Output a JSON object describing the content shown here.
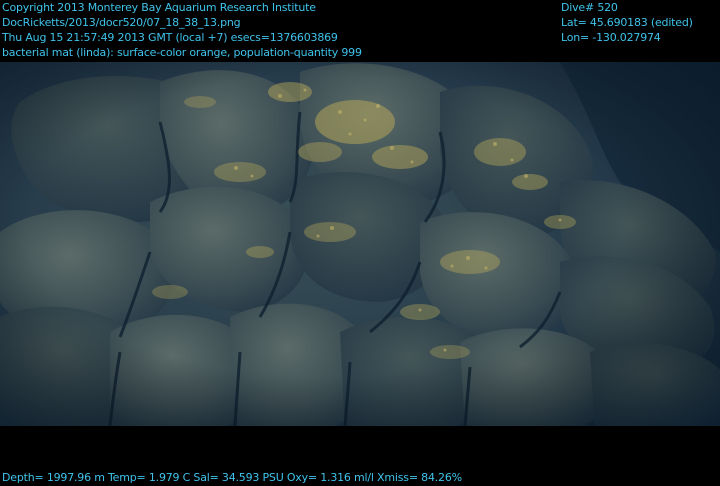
{
  "overlay": {
    "copyright": "Copyright 2013 Monterey Bay Aquarium Research Institute",
    "file_path": "DocRicketts/2013/docr520/07_18_38_13.png",
    "timestamp": "Thu Aug 15 21:57:49 2013 GMT (local +7)  esecs=1376603869",
    "annotation": "bacterial mat (linda): surface-color orange, population-quantity 999",
    "dive": "Dive# 520",
    "latitude": "Lat= 45.690183 (edited)",
    "longitude": "Lon= -130.027974",
    "sensors": "Depth= 1997.96 m  Temp= 1.979 C  Sal= 34.593 PSU  Oxy= 1.316 ml/l  Xmiss= 84.26%"
  },
  "colors": {
    "overlay_text": "#3fc3ea",
    "background": "#000000",
    "water": "#1c3444",
    "bacterial_mat": "#b2a45a"
  }
}
